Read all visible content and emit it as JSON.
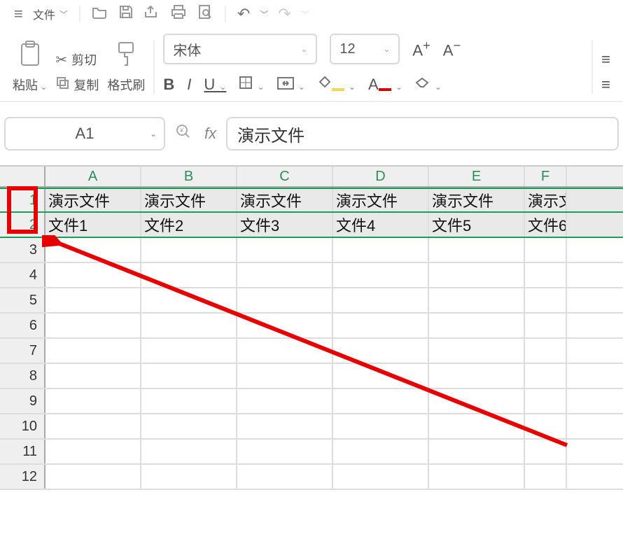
{
  "menu": {
    "file_label": "文件"
  },
  "ribbon": {
    "paste_label": "粘贴",
    "cut_label": "剪切",
    "copy_label": "复制",
    "format_painter_label": "格式刷",
    "font_name": "宋体",
    "font_size": "12"
  },
  "namebox": {
    "value": "A1"
  },
  "formula": {
    "value": "演示文件"
  },
  "columns": [
    "A",
    "B",
    "C",
    "D",
    "E",
    "F"
  ],
  "rows": [
    "1",
    "2",
    "3",
    "4",
    "5",
    "6",
    "7",
    "8",
    "9",
    "10",
    "11",
    "12"
  ],
  "cells": {
    "r1": [
      "演示文件",
      "演示文件",
      "演示文件",
      "演示文件",
      "演示文件",
      "演示文"
    ],
    "r2": [
      "文件1",
      "文件2",
      "文件3",
      "文件4",
      "文件5",
      "文件6"
    ]
  }
}
